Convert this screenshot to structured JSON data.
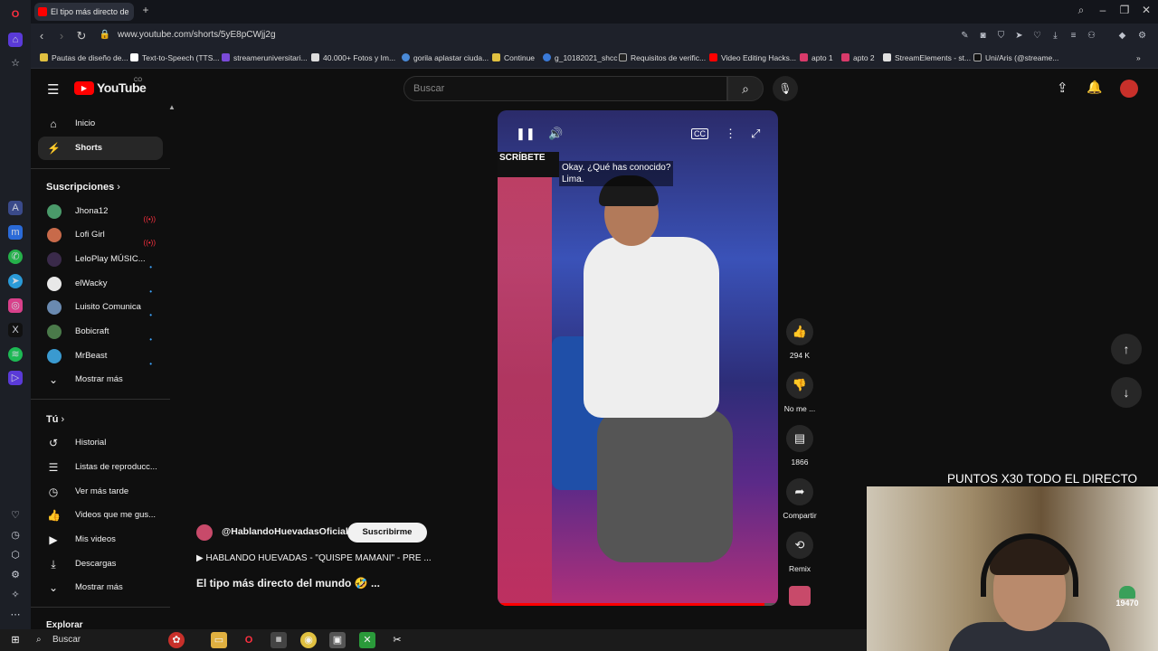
{
  "browser": {
    "tab_title": "El tipo más directo de",
    "url": "www.youtube.com/shorts/5yE8pCWjj2g",
    "bookmarks": [
      "Pautas de diseño de...",
      "Text-to-Speech (TTS...",
      "streameruniversitari...",
      "40.000+ Fotos y Im...",
      "gorila aplastar ciuda...",
      "Continue",
      "g_10182021_shcc",
      "Requisitos de verific...",
      "Video Editing Hacks...",
      "apto 1",
      "apto 2",
      "StreamElements - st...",
      "Uni/Aris (@streame..."
    ]
  },
  "masthead": {
    "logo": "YouTube",
    "logo_suffix": "CO",
    "search_placeholder": "Buscar"
  },
  "sidebar": {
    "main": [
      {
        "label": "Inicio",
        "icon": "home-icon"
      },
      {
        "label": "Shorts",
        "icon": "shorts-icon"
      }
    ],
    "subscriptions_header": "Suscripciones",
    "subscriptions": [
      {
        "label": "Jhona12",
        "color": "#4a9a6a",
        "live": true
      },
      {
        "label": "Lofi Girl",
        "color": "#c86a4a",
        "live": true
      },
      {
        "label": "LeloPlay MÚSIC...",
        "color": "#3a2a4a",
        "live": false
      },
      {
        "label": "elWacky",
        "color": "#e8e8e8",
        "live": false
      },
      {
        "label": "Luisito Comunica",
        "color": "#6a8ab0",
        "live": false
      },
      {
        "label": "Bobicraft",
        "color": "#4a7a4a",
        "live": false
      },
      {
        "label": "MrBeast",
        "color": "#3a9ad0",
        "live": false
      }
    ],
    "show_more": "Mostrar más",
    "you_header": "Tú",
    "you_items": [
      {
        "label": "Historial",
        "icon": "history-icon"
      },
      {
        "label": "Listas de reproducc...",
        "icon": "playlist-icon"
      },
      {
        "label": "Ver más tarde",
        "icon": "watch-later-icon"
      },
      {
        "label": "Videos que me gus...",
        "icon": "liked-icon"
      },
      {
        "label": "Mis videos",
        "icon": "my-videos-icon"
      },
      {
        "label": "Descargas",
        "icon": "downloads-icon"
      }
    ],
    "show_more_2": "Mostrar más",
    "explore_header": "Explorar"
  },
  "video": {
    "caption_line1": "Okay. ¿Qué has conocido?",
    "caption_line2": "Lima.",
    "banner": "SCRÍBETE",
    "progress": 0.95
  },
  "actions": {
    "likes": "294 K",
    "dislike": "No me ...",
    "comments": "1866",
    "share": "Compartir",
    "remix": "Remix"
  },
  "channel": {
    "name": "@HablandoHuevadasOficial",
    "subscribe": "Suscribirme",
    "music": "HABLANDO HUEVADAS - \"QUISPE MAMANI\" - PRE ...",
    "title": "El tipo más directo del mundo 🤣 ..."
  },
  "stream": {
    "overlay_text": "PUNTOS X30 TODO EL DIRECTO",
    "badge": "19470"
  },
  "taskbar": {
    "search": "Buscar"
  }
}
